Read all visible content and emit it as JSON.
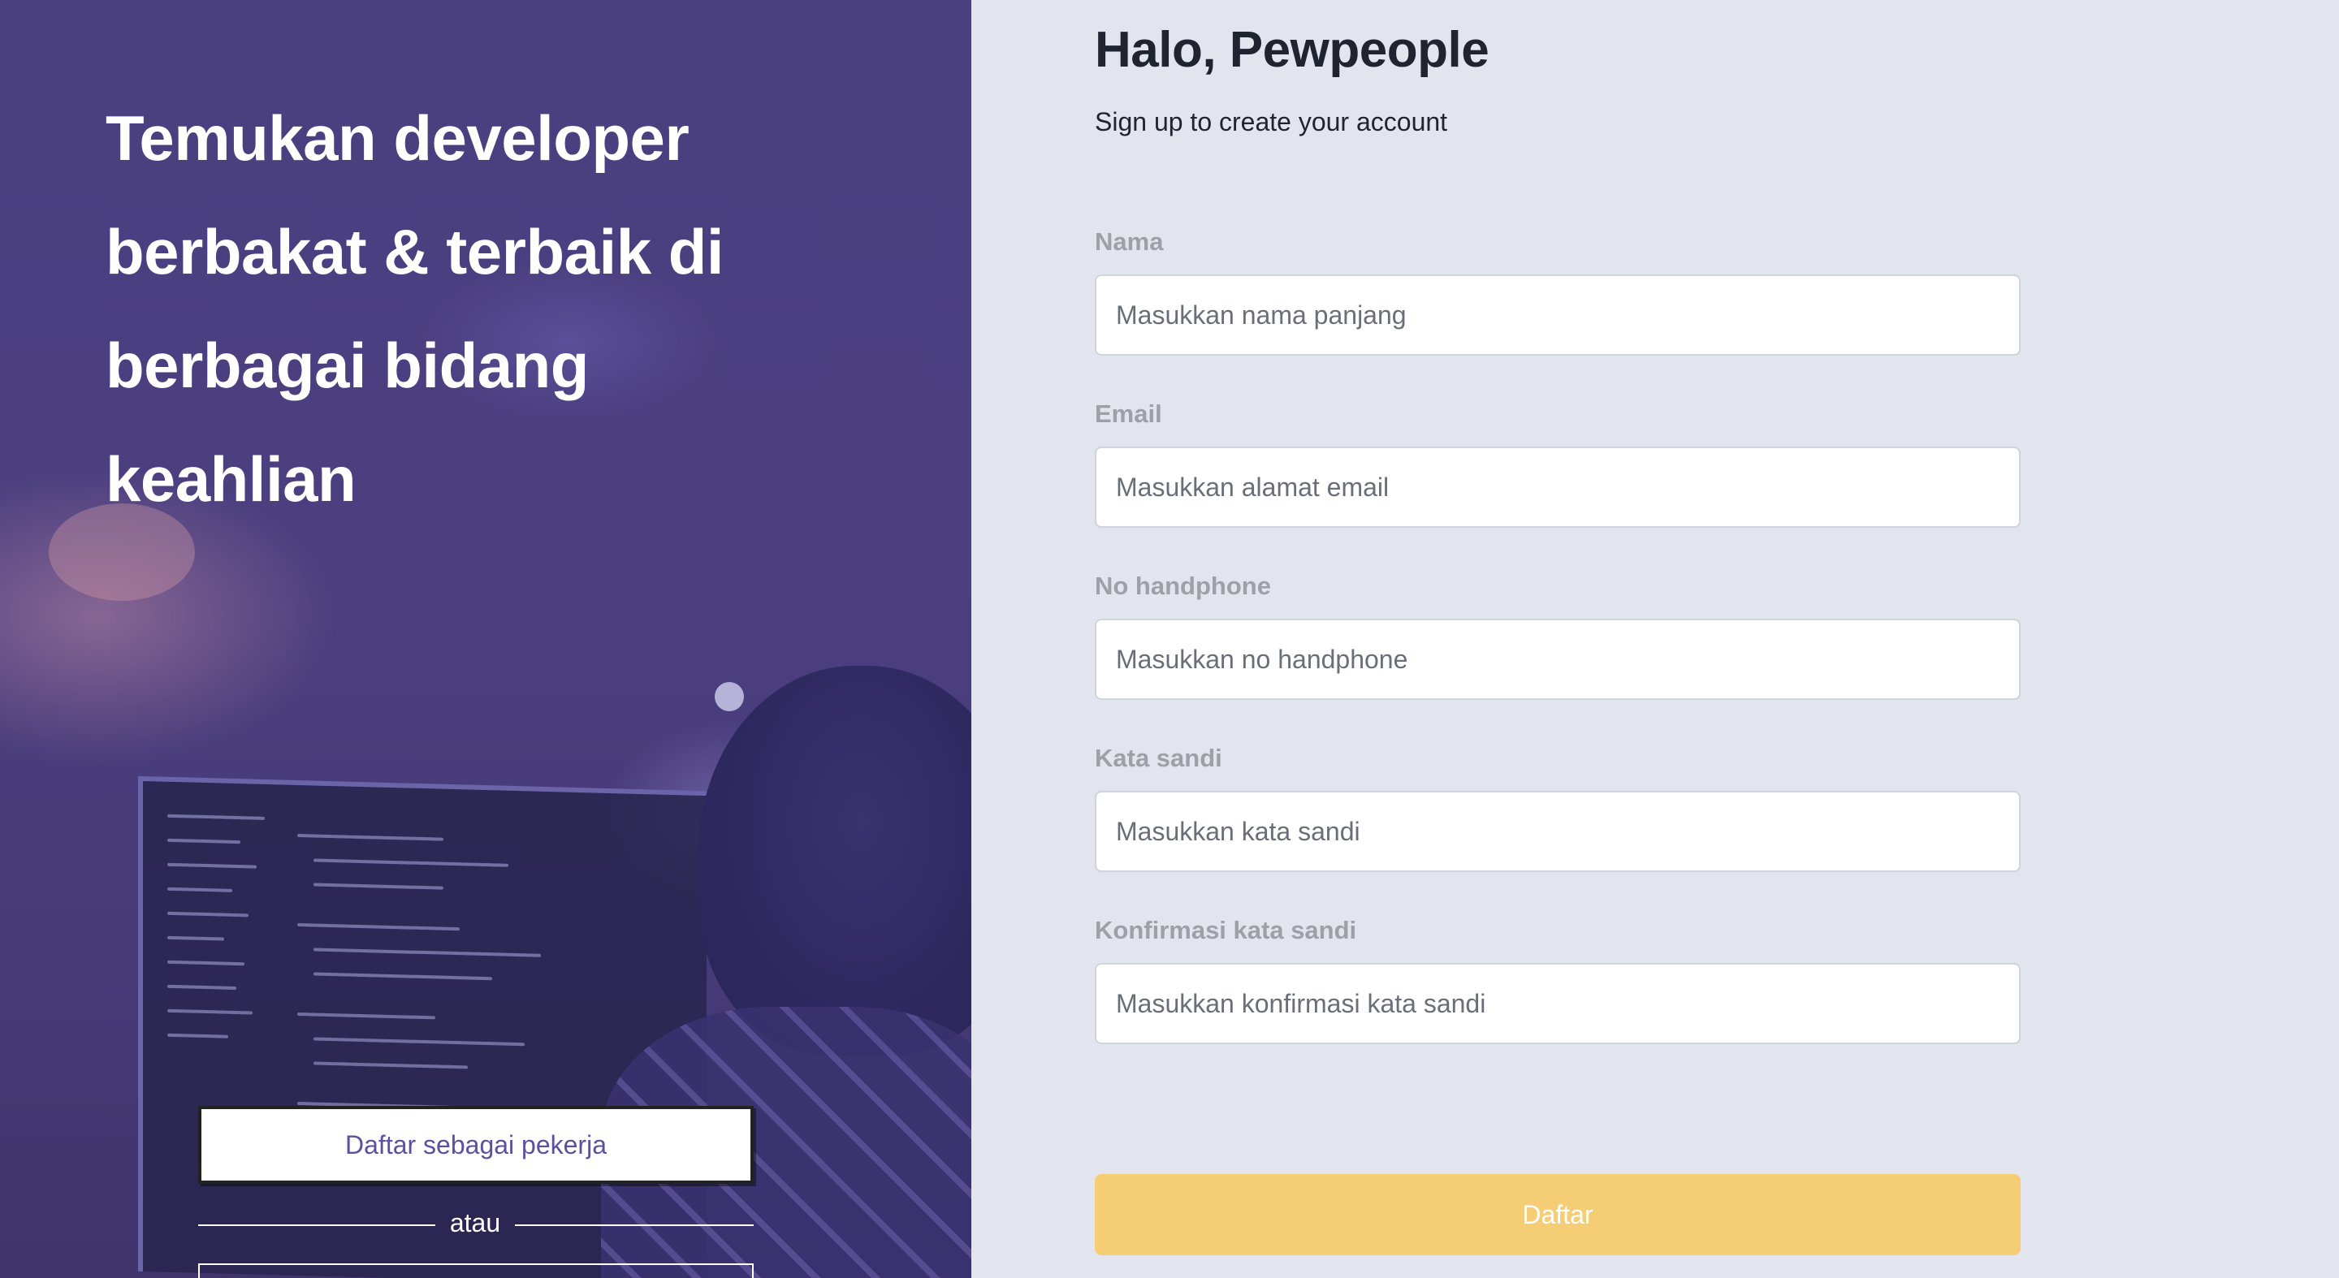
{
  "hero": {
    "headline": "Temukan developer\nberbakat & terbaik di\nberbagai bidang\nkeahlian",
    "worker_button": "Daftar sebagai pekerja",
    "divider_text": "atau"
  },
  "form": {
    "greeting": "Halo, Pewpeople",
    "subtitle": "Sign up to create your account",
    "fields": [
      {
        "label": "Nama",
        "placeholder": "Masukkan nama panjang",
        "type": "text"
      },
      {
        "label": "Email",
        "placeholder": "Masukkan alamat email",
        "type": "email"
      },
      {
        "label": "No handphone",
        "placeholder": "Masukkan no handphone",
        "type": "tel"
      },
      {
        "label": "Kata sandi",
        "placeholder": "Masukkan kata sandi",
        "type": "password"
      },
      {
        "label": "Konfirmasi kata sandi",
        "placeholder": "Masukkan konfirmasi kata sandi",
        "type": "password"
      }
    ],
    "submit": "Daftar"
  },
  "colors": {
    "hero_overlay": "#4b3f80",
    "form_background": "#e2e5ee",
    "submit_button": "#f4cd74",
    "worker_button_text": "#5e50a1",
    "label_text": "#9ea0a8"
  }
}
